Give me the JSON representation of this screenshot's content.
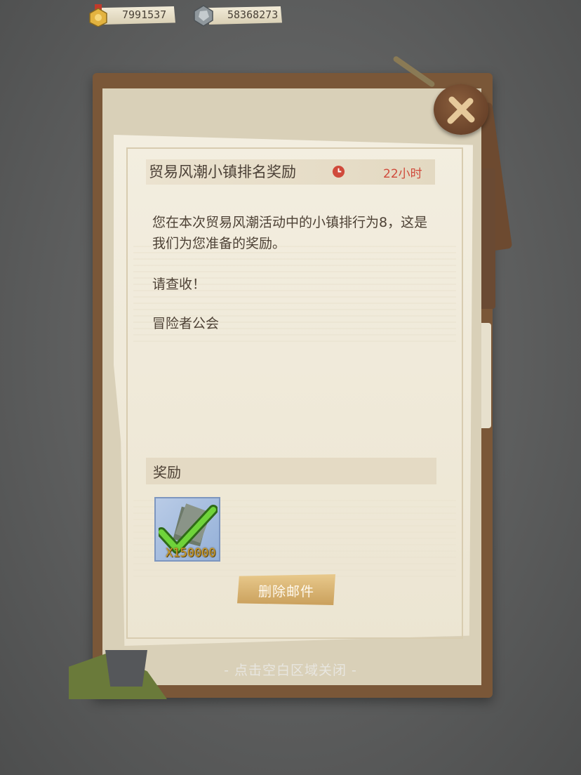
{
  "currency": {
    "gold": {
      "icon": "gold-medal-icon",
      "value": "7991537"
    },
    "iron": {
      "icon": "iron-ore-icon",
      "value": "58368273"
    }
  },
  "mail": {
    "title": "贸易风潮小镇排名奖励",
    "time_icon": "clock-icon",
    "time_left": "22小时",
    "body": [
      "您在本次贸易风潮活动中的小镇排行为8，这是我们为您准备的奖励。",
      "请查收！",
      "冒险者公会"
    ],
    "reward_title": "奖励",
    "rewards": [
      {
        "icon": "checkmark-cash-icon",
        "quantity": "X150000"
      }
    ],
    "delete_label": "删除邮件",
    "close_icon": "close-x-icon"
  },
  "hint": "- 点击空白区域关闭 -",
  "colors": {
    "time_red": "#d04a3b",
    "button_gold": "#caa05c",
    "paper": "#f3eee0"
  }
}
